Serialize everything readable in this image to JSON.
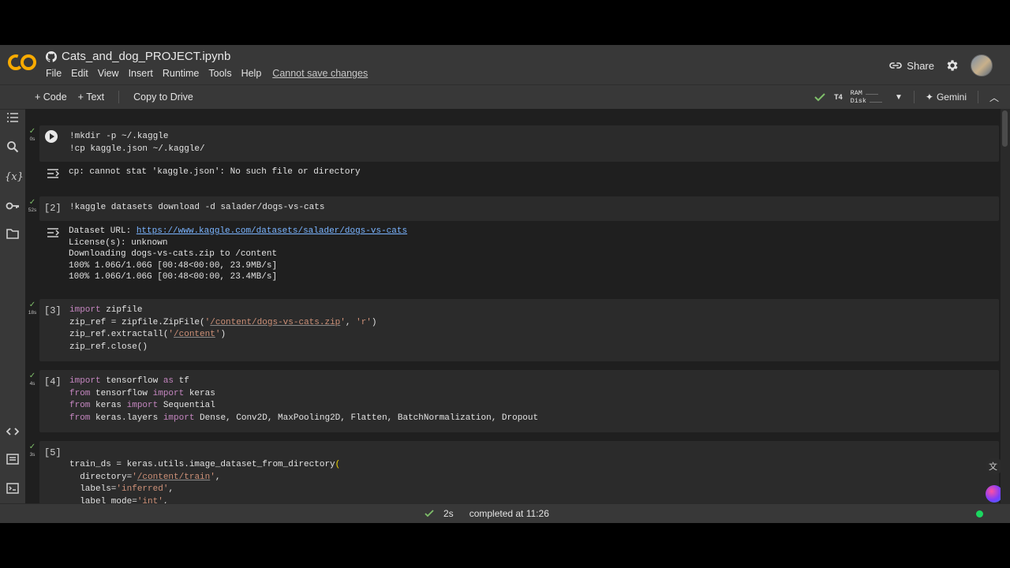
{
  "app": {
    "logo": "CO",
    "notebook_title": "Cats_and_dog_PROJECT.ipynb",
    "menu": [
      "File",
      "Edit",
      "View",
      "Insert",
      "Runtime",
      "Tools",
      "Help"
    ],
    "cannot_save": "Cannot save changes",
    "share": "Share"
  },
  "toolbar": {
    "code": "Code",
    "text": "Text",
    "copy_to_drive": "Copy to Drive",
    "runtime": "T4",
    "ram": "RAM",
    "disk": "Disk",
    "gemini": "Gemini"
  },
  "cells": [
    {
      "status_time": "0s",
      "exec": "",
      "output": "cp: cannot stat 'kaggle.json': No such file or directory"
    },
    {
      "status_time": "52s",
      "exec": "[2]",
      "output_label": "Dataset URL: ",
      "output_link": "https://www.kaggle.com/datasets/salader/dogs-vs-cats",
      "output_rest": "License(s): unknown\nDownloading dogs-vs-cats.zip to /content\n100% 1.06G/1.06G [00:48<00:00, 23.9MB/s]\n100% 1.06G/1.06G [00:48<00:00, 23.4MB/s]"
    },
    {
      "status_time": "18s",
      "exec": "[3]"
    },
    {
      "status_time": "4s",
      "exec": "[4]"
    },
    {
      "status_time": "3s",
      "exec": "[5]"
    }
  ],
  "footer": {
    "duration": "2s",
    "completed": "completed at 11:26"
  },
  "colors": {
    "accent_orange": "#f9ab00",
    "success_green": "#7fbf6a",
    "link_blue": "#7ab4ff",
    "keyword": "#c586c0",
    "string": "#ce9178"
  }
}
